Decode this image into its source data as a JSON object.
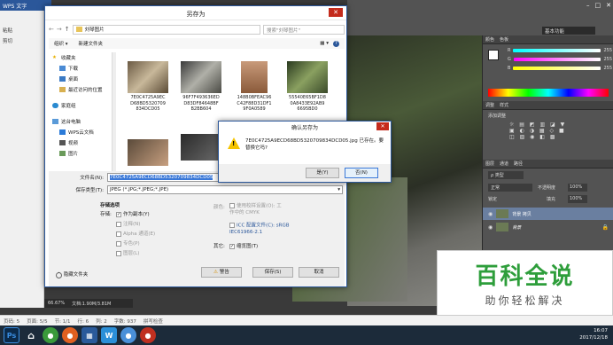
{
  "wps": {
    "title": "WPS 文字",
    "paste": "粘贴",
    "cut": "剪切"
  },
  "ps": {
    "workspace": "基本功能",
    "panel_tabs": {
      "color": "颜色",
      "swatches": "色板",
      "adjust": "调整",
      "styles": "样式",
      "adjust_add": "添加调整",
      "layers": "图层",
      "channels": "通道",
      "paths": "路径"
    },
    "rgb": {
      "r_label": "R",
      "g_label": "G",
      "b_label": "B",
      "r": "255",
      "g": "255",
      "b": "255"
    },
    "layers": {
      "kind": "类型",
      "mode": "正常",
      "opacity_label": "不透明度",
      "opacity": "100%",
      "lock_label": "锁定",
      "fill_label": "填充",
      "fill": "100%",
      "items": [
        {
          "name": "背景 拷贝"
        },
        {
          "name": "背景"
        }
      ]
    },
    "zoom": "66.67%",
    "doc": "文档:1.90M/3.81M"
  },
  "watermark": {
    "title": "百科全说",
    "subtitle": "助你轻松解决"
  },
  "status": {
    "page": "页码: 5",
    "pages": "页面: 5/5",
    "section": "节: 1/1",
    "row": "行: 6",
    "col": "列: 2",
    "words": "字数: 937",
    "spell": "拼写检查"
  },
  "clock": {
    "time": "16:07",
    "date": "2017/12/18"
  },
  "save_dialog": {
    "title": "另存为",
    "path": "刘琴图片",
    "search_placeholder": "搜索\"刘琴图片\"",
    "organize": "组织",
    "new_folder": "新建文件夹",
    "nav": [
      {
        "label": "收藏夹"
      },
      {
        "label": "下载"
      },
      {
        "label": "桌面"
      },
      {
        "label": "最近访问的位置"
      },
      {
        "label": "家庭组"
      },
      {
        "label": "这台电脑"
      },
      {
        "label": "WPS云文档"
      },
      {
        "label": "视频"
      },
      {
        "label": "图片"
      }
    ],
    "files": [
      {
        "name": "7E0C4725A9EC D68BD5320709 834DCD05"
      },
      {
        "name": "96F7F493636ED D83DF84648BF B2BB604"
      },
      {
        "name": "148B0BFEAC96 C42F88D31DF1 9F0A0589"
      },
      {
        "name": "55540E65BF1D8 0A8433E92AB9 6695BD0"
      }
    ],
    "filename_label": "文件名(N):",
    "filename": "7E0C4725A9ECD68BD5320709834DCD05",
    "filetype_label": "保存类型(T):",
    "filetype": "JPEG (*.JPG;*.JPEG;*.JPE)",
    "options_title": "存储选项",
    "save_label": "存储:",
    "opt_copy": "作为副本(Y)",
    "opt_notes": "注释(N)",
    "opt_alpha": "Alpha 通道(E)",
    "opt_spot": "专色(P)",
    "opt_layers": "图层(L)",
    "color_label": "颜色:",
    "opt_proof": "使用校样设置(O): 工作中的 CMYK",
    "opt_icc": "ICC 配置文件(C): sRGB IEC61966-2.1",
    "other_label": "其它:",
    "opt_thumb": "缩览图(T)",
    "warning": "警告",
    "save_btn": "保存(S)",
    "cancel_btn": "取消",
    "hide_folders": "隐藏文件夹"
  },
  "confirm": {
    "title": "确认另存为",
    "message": "7E0C4725A9ECD68BD5320709834DCD05.jpg 已存在。要替换它吗?",
    "yes": "是(Y)",
    "no": "否(N)"
  }
}
